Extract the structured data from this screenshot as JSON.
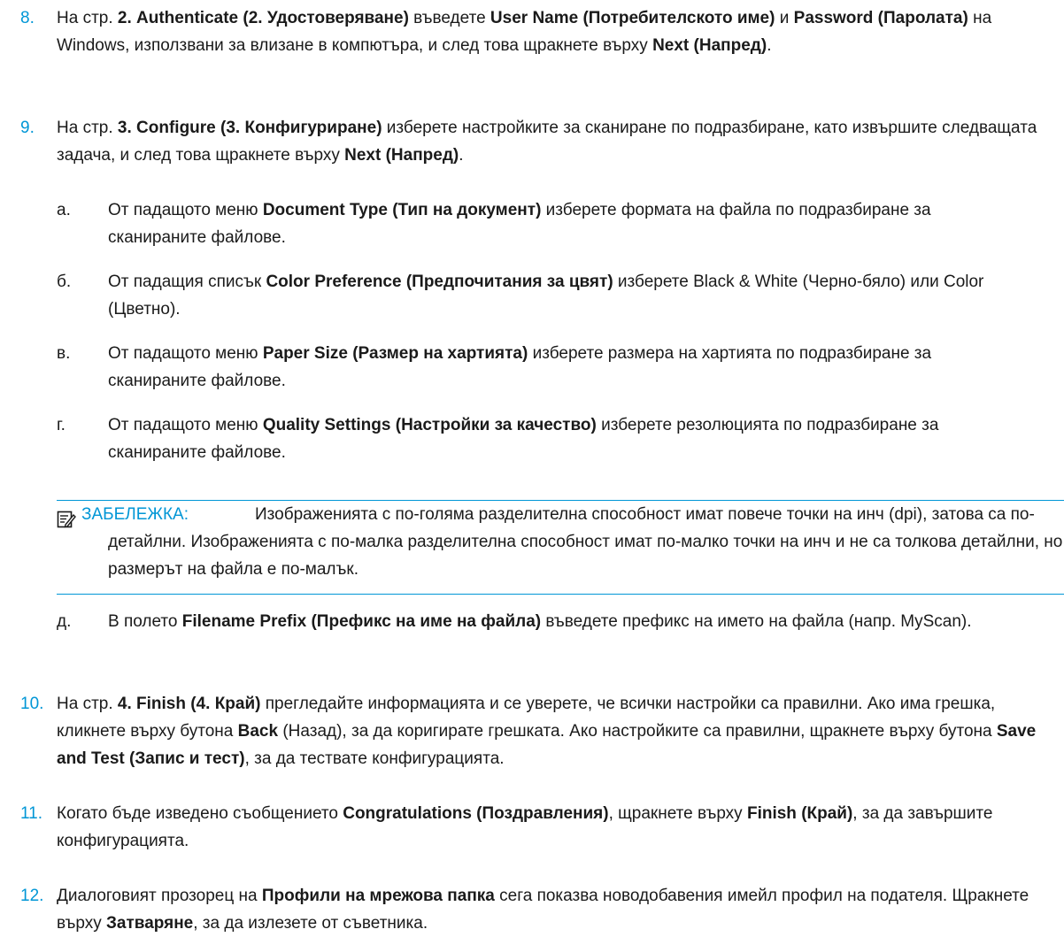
{
  "steps": [
    {
      "number": "8.",
      "parts": [
        "На стр. ",
        {
          "b": "2. Authenticate (2. Удостоверяване)"
        },
        " въведете ",
        {
          "b": "User Name (Потребителското име)"
        },
        " и ",
        {
          "b": "Password (Паролата)"
        },
        " на Windows, използвани за влизане в компютъра, и след това щракнете върху ",
        {
          "b": "Next (Напред)"
        },
        "."
      ]
    },
    {
      "number": "9.",
      "parts": [
        "На стр. ",
        {
          "b": "3. Configure (3. Конфигуриране)"
        },
        " изберете настройките за сканиране по подразбиране, като извършите следващата задача, и след това щракнете върху ",
        {
          "b": "Next (Напред)"
        },
        "."
      ],
      "substeps": [
        {
          "letter": "а.",
          "parts": [
            "От падащото меню ",
            {
              "b": "Document Type (Тип на документ)"
            },
            " изберете формата на файла по подразбиране за сканираните файлове."
          ]
        },
        {
          "letter": "б.",
          "parts": [
            "От падащия списък ",
            {
              "b": "Color Preference (Предпочитания за цвят)"
            },
            " изберете Black & White (Черно-бяло) или Color (Цветно)."
          ]
        },
        {
          "letter": "в.",
          "parts": [
            "От падащото меню ",
            {
              "b": "Paper Size (Размер на хартията)"
            },
            " изберете размера на хартията по подразбиране за сканираните файлове."
          ]
        },
        {
          "letter": "г.",
          "parts": [
            "От падащото меню ",
            {
              "b": "Quality Settings (Настройки за качество)"
            },
            " изберете резолюцията по подразбиране за сканираните файлове."
          ]
        },
        {
          "letter": "д.",
          "parts": [
            "В полето ",
            {
              "b": "Filename Prefix (Префикс на име на файла)"
            },
            " въведете префикс на името на файла (напр. MyScan)."
          ]
        }
      ],
      "note": {
        "label": "ЗАБЕЛЕЖКА:",
        "text": "Изображенията с по-голяма разделителна способност имат повече точки на инч (dpi), затова са по-детайлни. Изображенията с по-малка разделителна способност имат по-малко точки на инч и не са толкова детайлни, но размерът на файла е по-малък."
      }
    },
    {
      "number": "10.",
      "parts": [
        "На стр. ",
        {
          "b": "4. Finish (4. Край)"
        },
        " прегледайте информацията и се уверете, че всички настройки са правилни. Ако има грешка, кликнете върху бутона ",
        {
          "b": "Back"
        },
        " (Назад), за да коригирате грешката. Ако настройките са правилни, щракнете върху бутона ",
        {
          "b": "Save and Test (Запис и тест)"
        },
        ", за да тествате конфигурацията."
      ]
    },
    {
      "number": "11.",
      "parts": [
        "Когато бъде изведено съобщението ",
        {
          "b": "Congratulations (Поздравления)"
        },
        ", щракнете върху ",
        {
          "b": "Finish (Край)"
        },
        ", за да завършите конфигурацията."
      ]
    },
    {
      "number": "12.",
      "parts": [
        "Диалоговият прозорец на ",
        {
          "b": "Профили на мрежова папка"
        },
        " сега показва новодобавения имейл профил на подателя. Щракнете върху ",
        {
          "b": "Затваряне"
        },
        ", за да излезете от съветника."
      ]
    }
  ],
  "colors": {
    "accent": "#0096d6",
    "text": "#1a1a1a"
  },
  "note_icon": "note-pencil-icon"
}
